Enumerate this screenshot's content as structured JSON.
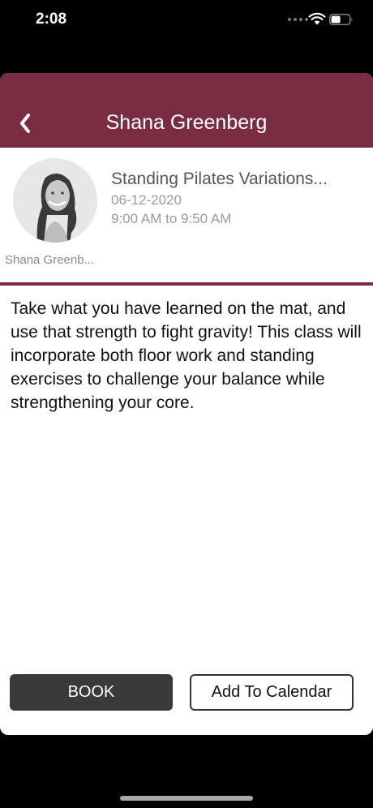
{
  "status_bar": {
    "time": "2:08"
  },
  "nav": {
    "title": "Shana Greenberg"
  },
  "class_info": {
    "instructor_caption": "Shana Greenb...",
    "title": "Standing Pilates Variations...",
    "date": "06-12-2020",
    "time": "9:00 AM to 9:50 AM"
  },
  "description": "Take what you have learned on the mat, and use that strength to fight gravity! This class will incorporate both floor work and standing exercises to challenge your balance while strengthening your core.",
  "actions": {
    "book_label": "BOOK",
    "calendar_label": "Add To Calendar"
  },
  "colors": {
    "accent": "#7a2c42",
    "book_bg": "#3a3a3a"
  }
}
